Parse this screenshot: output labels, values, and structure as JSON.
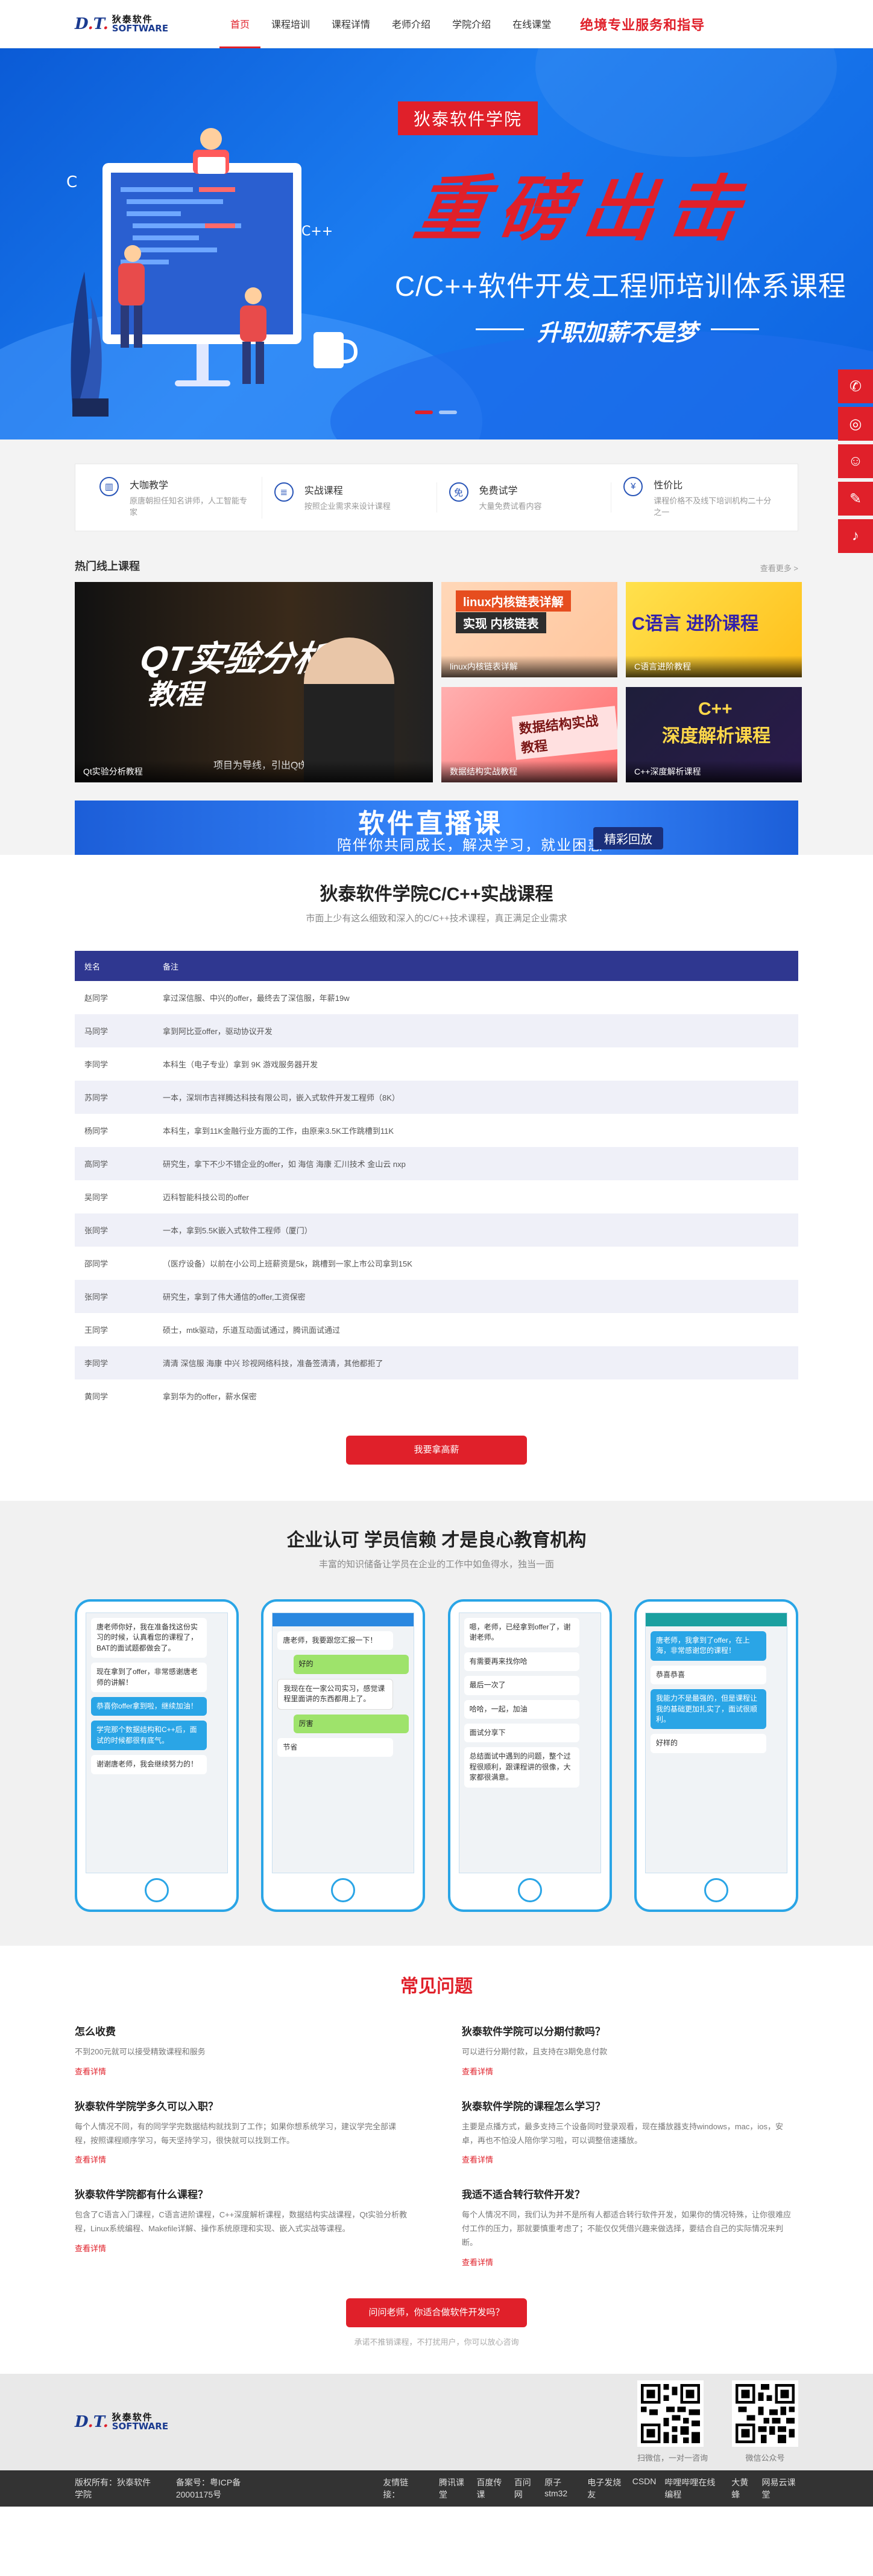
{
  "brand": {
    "mark": "D.T.",
    "mark_tail": "Software",
    "cn": "狄泰软件",
    "en": "SOFTWARE"
  },
  "nav": [
    {
      "label": "首页",
      "active": true
    },
    {
      "label": "课程培训"
    },
    {
      "label": "课程详情"
    },
    {
      "label": "老师介绍"
    },
    {
      "label": "学院介绍"
    },
    {
      "label": "在线课堂"
    }
  ],
  "header_slogan": "绝境专业服务和指导",
  "banner": {
    "tag": "狄泰软件学院",
    "big": "重磅出击",
    "title": "C/C++软件开发工程师培训体系课程",
    "subtitle": "升职加薪不是梦"
  },
  "sidebar_icons": [
    "wechat-icon",
    "weibo-icon",
    "qq-icon",
    "edit-icon",
    "bell-icon"
  ],
  "features": [
    {
      "title": "大咖教学",
      "desc": "原唐朝担任知名讲师，人工智能专家",
      "icon": "▥"
    },
    {
      "title": "实战课程",
      "desc": "按照企业需求来设计课程",
      "icon": "≣"
    },
    {
      "title": "免费试学",
      "desc": "大量免费试看内容",
      "icon": "免"
    },
    {
      "title": "性价比",
      "desc": "课程价格不及线下培训机构二十分之一",
      "icon": "¥"
    }
  ],
  "hot": {
    "title": "热门线上课程",
    "more": "查看更多 >",
    "courses": [
      {
        "caption": "Qt实验分析教程",
        "t1": "QT实验分析",
        "t2": "教程",
        "note": "项目为导线，引出Qt知识点"
      },
      {
        "caption": "linux内核链表详解",
        "tag1": "linux内核链表详解",
        "tag2": "实现 内核链表"
      },
      {
        "caption": "C语言进阶教程",
        "tt": "C语言 进阶课程"
      },
      {
        "caption": "数据结构实战教程",
        "tt": "数据结构实战教程"
      },
      {
        "caption": "C++深度解析课程",
        "tt": "C++",
        "tt2": "深度解析课程"
      }
    ]
  },
  "live": {
    "title": "软件直播课",
    "sub": "陪伴你共同成长，解决学习，就业困惑",
    "btn": "精彩回放"
  },
  "table_section": {
    "title": "狄泰软件学院C/C++实战课程",
    "subtitle": "市面上少有这么细致和深入的C/C++技术课程，真正满足企业需求",
    "headers": [
      "姓名",
      "备注"
    ],
    "rows": [
      [
        "赵同学",
        "拿过深信服、中兴的offer，最终去了深信服，年薪19w"
      ],
      [
        "马同学",
        "拿到阿比亚offer，驱动协议开发"
      ],
      [
        "李同学",
        "本科生（电子专业）拿到 9K 游戏服务器开发"
      ],
      [
        "苏同学",
        "一本，深圳市吉祥腾达科技有限公司，嵌入式软件开发工程师（8K）"
      ],
      [
        "杨同学",
        "本科生，拿到11K金融行业方面的工作，由原来3.5K工作跳槽到11K"
      ],
      [
        "高同学",
        "研究生，拿下不少不错企业的offer，如 海信 海康 汇川技术 金山云 nxp"
      ],
      [
        "吴同学",
        "迈科智能科技公司的offer"
      ],
      [
        "张同学",
        "一本，拿到5.5K嵌入式软件工程师（厦门）"
      ],
      [
        "邵同学",
        "（医疗设备）以前在小公司上班薪资是5k，跳槽到一家上市公司拿到15K"
      ],
      [
        "张同学",
        "研究生，拿到了伟大通信的offer,工资保密"
      ],
      [
        "王同学",
        "硕士，mtk驱动，乐道互动面试通过，腾讯面试通过"
      ],
      [
        "李同学",
        "清清 深信服 海康 中兴 珍视网络科技，准备签清清，其他都拒了"
      ],
      [
        "黄同学",
        "拿到华为的offer，薪水保密"
      ]
    ],
    "button": "我要拿高薪"
  },
  "trust": {
    "title": "企业认可 学员信赖 才是良心教育机构",
    "subtitle": "丰富的知识储备让学员在企业的工作中如鱼得水，独当一面",
    "phones": [
      {
        "bar": "",
        "bubbles": [
          {
            "k": "bl",
            "t": "唐老师你好，我在准备找这份实习的时候，认真看您的课程了，BAT的面试题都做会了。"
          },
          {
            "k": "bl",
            "t": "现在拿到了offer，非常感谢唐老师的讲解！"
          },
          {
            "k": "bb",
            "t": "恭喜你offer拿到啦，继续加油！"
          },
          {
            "k": "bb",
            "t": "学完那个数据结构和C++后，面试的时候都很有底气。"
          },
          {
            "k": "bl",
            "t": "谢谢唐老师，我会继续努力的！"
          }
        ]
      },
      {
        "bar": "bar",
        "bubbles": [
          {
            "k": "bl",
            "t": "唐老师，我要跟您汇报一下！"
          },
          {
            "k": "bg",
            "t": "好的"
          },
          {
            "k": "bt",
            "t": "我现在在一家公司实习，感觉课程里面讲的东西都用上了。"
          },
          {
            "k": "bg",
            "t": "厉害"
          },
          {
            "k": "bl",
            "t": "节省"
          }
        ]
      },
      {
        "bar": "",
        "bubbles": [
          {
            "k": "bl",
            "t": "嗯，老师，已经拿到offer了，谢谢老师。"
          },
          {
            "k": "bl",
            "t": "有需要再来找你哈"
          },
          {
            "k": "bl",
            "t": "最后一次了"
          },
          {
            "k": "bl",
            "t": "哈哈，一起，加油"
          },
          {
            "k": "bl",
            "t": "面试分享下"
          },
          {
            "k": "bl",
            "t": "总结面试中遇到的问题，整个过程很顺利，跟课程讲的很像，大家都很满意。"
          }
        ]
      },
      {
        "bar": "bar2",
        "bubbles": [
          {
            "k": "bb",
            "t": "唐老师，我拿到了offer，在上海，非常感谢您的课程！"
          },
          {
            "k": "bl",
            "t": "恭喜恭喜"
          },
          {
            "k": "bb",
            "t": "我能力不是最强的，但是课程让我的基础更加扎实了，面试很顺利。"
          },
          {
            "k": "bl",
            "t": "好样的"
          }
        ]
      }
    ]
  },
  "faq": {
    "title": "常见问题",
    "items": [
      {
        "q": "怎么收费",
        "a": "不到200元就可以接受精致课程和服务"
      },
      {
        "q": "狄泰软件学院可以分期付款吗？",
        "a": "可以进行分期付款，且支持在3期免息付款"
      },
      {
        "q": "狄泰软件学院学多久可以入职？",
        "a": "每个人情况不同，有的同学学完数据结构就找到了工作；如果你想系统学习，建议学完全部课程，按照课程顺序学习，每天坚持学习，很快就可以找到工作。"
      },
      {
        "q": "狄泰软件学院的课程怎么学习？",
        "a": "主要是点播方式，最多支持三个设备同时登录观看，现在播放器支持windows，mac，ios，安卓，再也不怕没人陪你学习啦，可以调整倍速播放。"
      },
      {
        "q": "狄泰软件学院都有什么课程？",
        "a": "包含了C语言入门课程，C语言进阶课程，C++深度解析课程，数据结构实战课程，Qt实验分析教程，Linux系统编程、Makefile详解、操作系统原理和实现、嵌入式实战等课程。"
      },
      {
        "q": "我适不适合转行软件开发？",
        "a": "每个人情况不同，我们认为并不是所有人都适合转行软件开发，如果你的情况特殊，让你很难应付工作的压力，那就要慎重考虑了；不能仅仅凭借兴趣来做选择，要结合自己的实际情况来判断。"
      }
    ],
    "more": "查看详情",
    "button": "问问老师，你适合做软件开发吗？",
    "note": "承诺不推销课程，不打扰用户，你可以放心咨询"
  },
  "footer": {
    "qr1_label": "扫微信，一对一咨询",
    "qr2_label": "微信公众号"
  },
  "copyright": {
    "left": "版权所有：狄泰软件学院",
    "icp": "备案号：粤ICP备20001175号",
    "links_label": "友情链接：",
    "links": [
      "腾讯课堂",
      "百度传课",
      "百问网",
      "原子stm32",
      "电子发烧友",
      "CSDN",
      "哔哩哔哩在线编程",
      "大黄蜂",
      "网易云课堂"
    ]
  }
}
